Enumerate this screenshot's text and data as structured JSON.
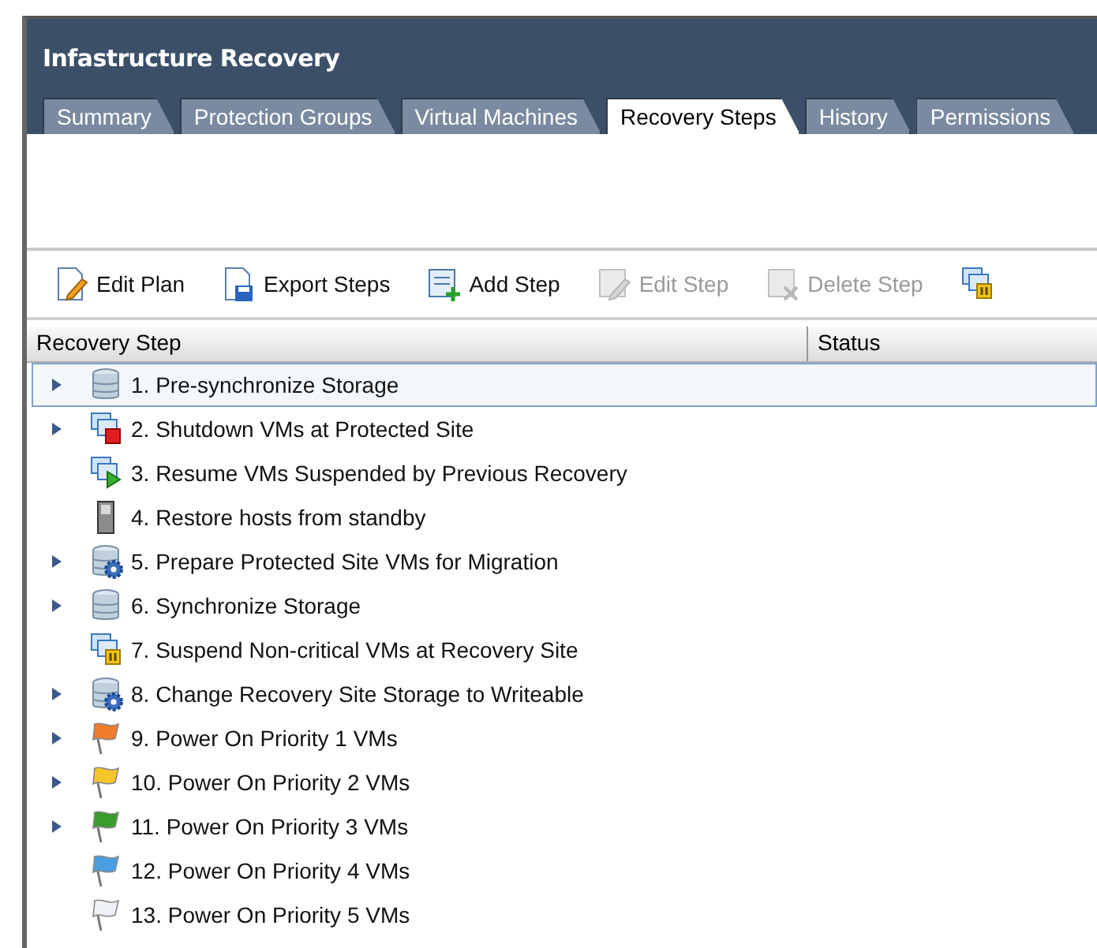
{
  "window": {
    "title": "Infastructure Recovery"
  },
  "tabs": [
    {
      "label": "Summary",
      "selected": false
    },
    {
      "label": "Protection Groups",
      "selected": false
    },
    {
      "label": "Virtual Machines",
      "selected": false
    },
    {
      "label": "Recovery Steps",
      "selected": true
    },
    {
      "label": "History",
      "selected": false
    },
    {
      "label": "Permissions",
      "selected": false
    }
  ],
  "toolbar": [
    {
      "label": "Edit Plan",
      "kind": "edit-plan",
      "disabled": false
    },
    {
      "label": "Export Steps",
      "kind": "export",
      "disabled": false
    },
    {
      "label": "Add Step",
      "kind": "add",
      "disabled": false
    },
    {
      "label": "Edit Step",
      "kind": "edit-step",
      "disabled": true
    },
    {
      "label": "Delete Step",
      "kind": "delete",
      "disabled": true
    },
    {
      "kind": "vm-pause"
    }
  ],
  "table": {
    "columns": [
      "Recovery Step",
      "Status"
    ],
    "rows": [
      {
        "label": "1. Pre-synchronize Storage",
        "kind": "storage",
        "expandable": true,
        "selected": true
      },
      {
        "label": "2. Shutdown VMs at Protected Site",
        "kind": "vm-stop",
        "expandable": true,
        "selected": false
      },
      {
        "label": "3. Resume VMs Suspended by Previous Recovery",
        "kind": "vm-play",
        "expandable": false,
        "selected": false
      },
      {
        "label": "4. Restore hosts from standby",
        "kind": "host",
        "expandable": false,
        "selected": false
      },
      {
        "label": "5. Prepare Protected Site VMs for Migration",
        "kind": "storage-gear",
        "expandable": true,
        "selected": false
      },
      {
        "label": "6. Synchronize Storage",
        "kind": "storage",
        "expandable": true,
        "selected": false
      },
      {
        "label": "7. Suspend Non-critical VMs at Recovery Site",
        "kind": "vm-pause",
        "expandable": false,
        "selected": false
      },
      {
        "label": "8. Change Recovery Site Storage to Writeable",
        "kind": "storage-gear",
        "expandable": true,
        "selected": false
      },
      {
        "label": "9. Power On Priority 1 VMs",
        "kind": "flag",
        "color": "#f07d2a",
        "expandable": true,
        "selected": false
      },
      {
        "label": "10. Power On Priority 2 VMs",
        "kind": "flag",
        "color": "#f5c52a",
        "expandable": true,
        "selected": false
      },
      {
        "label": "11. Power On Priority 3 VMs",
        "kind": "flag",
        "color": "#3a9a2a",
        "expandable": true,
        "selected": false
      },
      {
        "label": "12. Power On Priority 4 VMs",
        "kind": "flag",
        "color": "#4a9de0",
        "expandable": false,
        "selected": false
      },
      {
        "label": "13. Power On Priority 5 VMs",
        "kind": "flag",
        "color": "#eef2f6",
        "expandable": false,
        "selected": false
      }
    ]
  }
}
